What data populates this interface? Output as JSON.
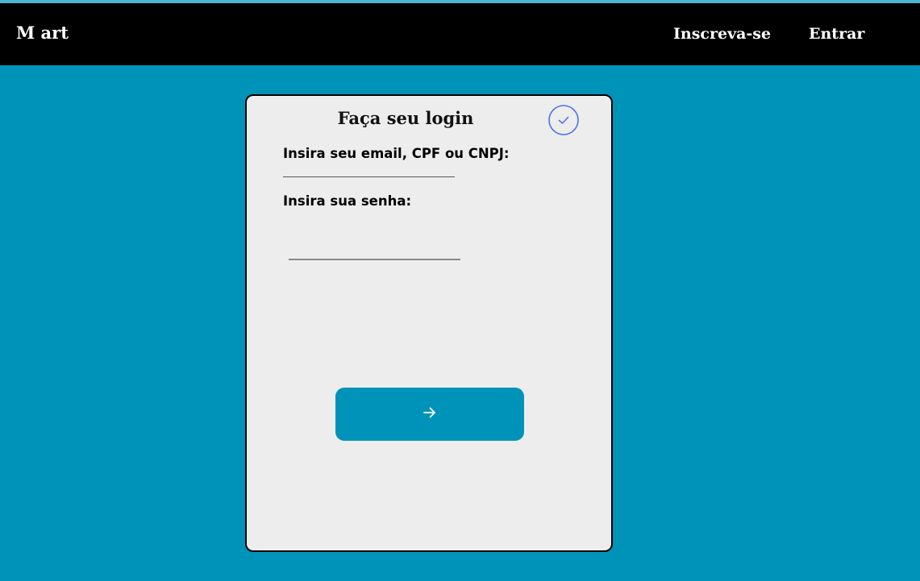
{
  "navbar": {
    "brand": "M art",
    "signup_label": "Inscreva-se",
    "login_label": "Entrar"
  },
  "login_card": {
    "title": "Faça seu login",
    "email_label": "Insira seu email, CPF ou CNPJ:",
    "email_value": "",
    "password_label": "Insira sua senha:",
    "password_value": "",
    "submit_icon": "arrow-right-icon",
    "status_icon": "check-circle-icon"
  },
  "colors": {
    "background": "#0093b9",
    "navbar": "#000000",
    "card": "#ededed",
    "button": "#0093b9",
    "check_icon": "#4b72f0"
  }
}
